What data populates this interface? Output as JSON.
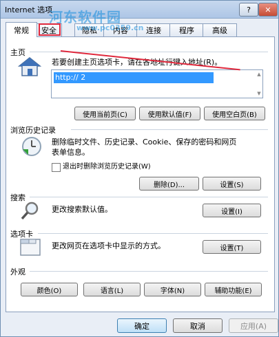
{
  "window": {
    "title": "Internet 选项",
    "help": "?",
    "close": "✕"
  },
  "watermark": {
    "line1": "河东软件园",
    "line2": "www.pc0359.cn"
  },
  "tabs": [
    {
      "label": "常规"
    },
    {
      "label": "安全"
    },
    {
      "label": "隐私"
    },
    {
      "label": "内容"
    },
    {
      "label": "连接"
    },
    {
      "label": "程序"
    },
    {
      "label": "高级"
    }
  ],
  "home": {
    "title": "主页",
    "desc": "若要创建主页选项卡，请在各地址行键入地址(R)。",
    "url": "http://                              2",
    "btn_current": "使用当前页(C)",
    "btn_default": "使用默认值(F)",
    "btn_blank": "使用空白页(B)"
  },
  "history": {
    "title": "浏览历史记录",
    "desc_line1": "删除临时文件、历史记录、Cookie、保存的密码和网页",
    "desc_line2": "表单信息。",
    "checkbox_label": "退出时删除浏览历史记录(W)",
    "btn_delete": "删除(D)...",
    "btn_settings": "设置(S)"
  },
  "search": {
    "title": "搜索",
    "desc": "更改搜索默认值。",
    "btn_settings": "设置(I)"
  },
  "tabs_section": {
    "title": "选项卡",
    "desc": "更改网页在选项卡中显示的方式。",
    "btn_settings": "设置(T)"
  },
  "appearance": {
    "title": "外观",
    "btn_colors": "颜色(O)",
    "btn_languages": "语言(L)",
    "btn_fonts": "字体(N)",
    "btn_accessibility": "辅助功能(E)"
  },
  "footer": {
    "ok": "确定",
    "cancel": "取消",
    "apply": "应用(A)"
  }
}
